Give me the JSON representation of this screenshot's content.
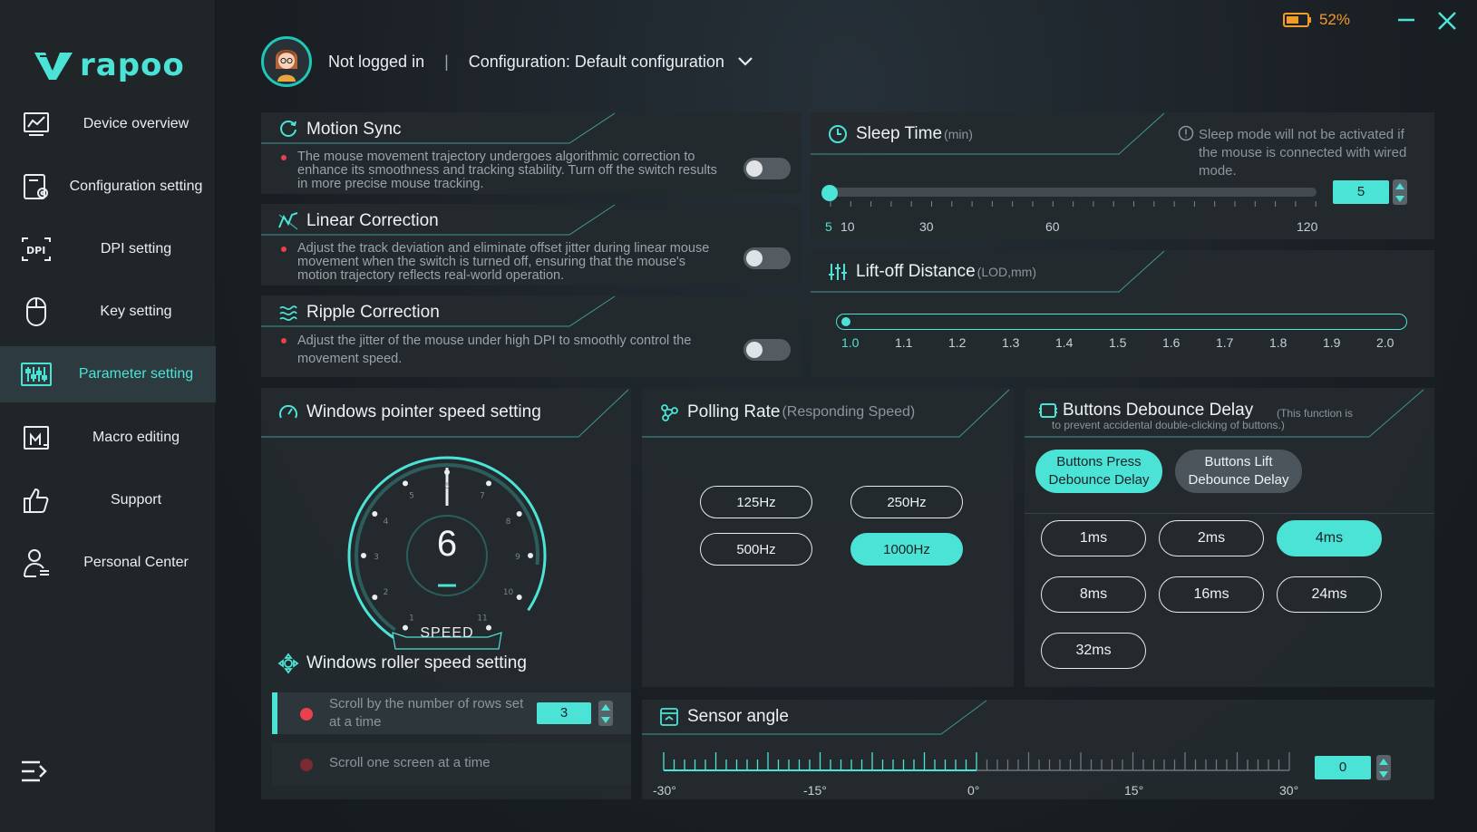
{
  "app": {
    "logo_text": "rapoo",
    "battery_pct": "52%"
  },
  "sidebar": {
    "items": [
      {
        "label": "Device overview",
        "icon": "chart-monitor-icon"
      },
      {
        "label": "Configuration setting",
        "icon": "config-gear-icon"
      },
      {
        "label": "DPI setting",
        "icon": "dpi-icon"
      },
      {
        "label": "Key setting",
        "icon": "mouse-icon"
      },
      {
        "label": "Parameter setting",
        "icon": "sliders-icon",
        "active": true
      },
      {
        "label": "Macro editing",
        "icon": "macro-icon"
      },
      {
        "label": "Support",
        "icon": "thumbs-up-icon"
      },
      {
        "label": "Personal Center",
        "icon": "user-icon"
      }
    ]
  },
  "header": {
    "login": "Not logged in",
    "separator": "|",
    "configuration": "Configuration: Default configuration"
  },
  "motion_sync": {
    "title": "Motion Sync",
    "desc": "The mouse movement trajectory undergoes algorithmic correction to enhance its smoothness and tracking stability. Turn off the switch results in more precise mouse tracking.",
    "enabled": false
  },
  "linear_correction": {
    "title": "Linear Correction",
    "desc": "Adjust the track deviation and eliminate offset jitter during linear mouse movement when the switch is turned off, ensuring that the mouse's motion trajectory reflects real-world operation.",
    "enabled": false
  },
  "ripple_correction": {
    "title": "Ripple Correction",
    "desc": "Adjust the jitter of the mouse under high DPI to smoothly control the movement speed.",
    "enabled": false
  },
  "sleep_time": {
    "title": "Sleep Time",
    "unit": "(min)",
    "note": "Sleep mode will not be activated if the mouse is connected with wired mode.",
    "value": "5",
    "ticks": [
      "5",
      "10",
      "30",
      "60",
      "120"
    ]
  },
  "lod": {
    "title": "Lift-off Distance",
    "unit": "(LOD,mm)",
    "value": 1.0,
    "ticks": [
      "1.0",
      "1.1",
      "1.2",
      "1.3",
      "1.4",
      "1.5",
      "1.6",
      "1.7",
      "1.8",
      "1.9",
      "2.0"
    ]
  },
  "pointer_speed": {
    "title": "Windows pointer speed setting",
    "value": "6",
    "gauge_label": "SPEED",
    "dial_numbers": [
      "1",
      "2",
      "3",
      "4",
      "5",
      "6",
      "7",
      "8",
      "9",
      "10",
      "11"
    ]
  },
  "roller_speed": {
    "title": "Windows roller speed setting",
    "option_rows": "Scroll by the number of rows set at a time",
    "rows_value": "3",
    "option_screen": "Scroll one screen at a time"
  },
  "polling_rate": {
    "title": "Polling Rate",
    "subtitle": "(Responding Speed)",
    "options": [
      "125Hz",
      "250Hz",
      "500Hz",
      "1000Hz"
    ],
    "selected": "1000Hz"
  },
  "debounce": {
    "title": "Buttons Debounce Delay",
    "note": "(This function is to prevent accidental double-clicking of buttons.)",
    "tab_press": "Buttons Press Debounce Delay",
    "tab_lift": "Buttons Lift Debounce Delay",
    "options": [
      "1ms",
      "2ms",
      "4ms",
      "8ms",
      "16ms",
      "24ms",
      "32ms"
    ],
    "selected": "4ms"
  },
  "sensor_angle": {
    "title": "Sensor angle",
    "value": "0",
    "ticks": [
      "-30°",
      "-15°",
      "0°",
      "15°",
      "30°"
    ]
  },
  "colors": {
    "accent": "#4ce3d7",
    "battery": "#f29b28",
    "dot": "#e8414e"
  }
}
